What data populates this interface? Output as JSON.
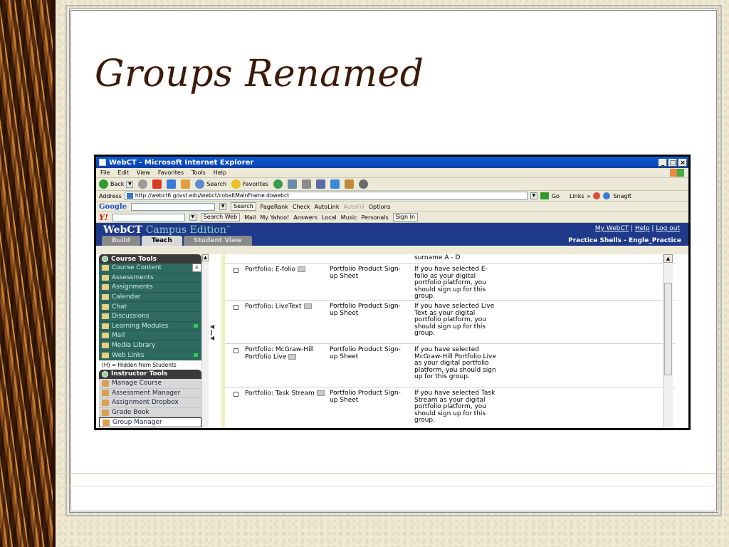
{
  "slide": {
    "title": "Groups Renamed"
  },
  "browser": {
    "window_title": "WebCT - Microsoft Internet Explorer",
    "window_buttons": [
      "_",
      "□",
      "×"
    ],
    "menu": [
      "File",
      "Edit",
      "View",
      "Favorites",
      "Tools",
      "Help"
    ],
    "toolbar": {
      "back": "Back",
      "search": "Search",
      "favorites": "Favorites"
    },
    "address_label": "Address",
    "address_value": "http://webct6.govst.edu/webct/cobaltMainFrame.dowebct",
    "go_label": "Go",
    "links_label": "Links",
    "snagit_label": "SnagIt"
  },
  "google_bar": {
    "logo": "Google",
    "search_label": "Search",
    "pagerank_label": "PageRank",
    "check_label": "Check",
    "autolink_label": "AutoLink",
    "autofill_label": "AutoFill",
    "options_label": "Options"
  },
  "yahoo_bar": {
    "logo": "Y!",
    "search_web_label": "Search Web",
    "items": [
      "Mail",
      "My Yahoo!",
      "Answers",
      "Local",
      "Music",
      "Personals",
      "Sign In"
    ]
  },
  "webct": {
    "logo": "WebCT",
    "edition": "Campus Edition",
    "trademark": "™",
    "header_links": [
      "My WebCT",
      "Help",
      "Log out"
    ],
    "tabs": [
      "Build",
      "Teach",
      "Student View"
    ],
    "active_tab": "Teach",
    "course_name": "Practice Shells - Engle_Practice"
  },
  "sidebar": {
    "course_tools_header": "Course Tools",
    "course_tools": [
      "Course Content",
      "Assessments",
      "Assignments",
      "Calendar",
      "Chat",
      "Discussions",
      "Learning Modules",
      "Mail",
      "Media Library",
      "Web Links"
    ],
    "hidden_note": "(H) = Hidden from Students",
    "instructor_tools_header": "Instructor Tools",
    "instructor_tools": [
      "Manage Course",
      "Assessment Manager",
      "Assignment Dropbox",
      "Grade Book",
      "Group Manager"
    ],
    "selected_instructor_tool": "Group Manager"
  },
  "groups_table": {
    "top_fragment": "surname A - D",
    "rows": [
      {
        "name": "Portfolio: E-folio",
        "sheet": "Portfolio Product Sign-up Sheet",
        "desc": "If you have selected E-folio as your digital portfolio platform, you should sign up for this group."
      },
      {
        "name": "Portfolio: LiveText",
        "sheet": "Portfolio Product Sign-up Sheet",
        "desc": "If you have selected Live Text as your digital portfolio platform, you should sign up for this group."
      },
      {
        "name": "Portfolio: McGraw-Hill Portfolio Live",
        "sheet": "Portfolio Product Sign-up Sheet",
        "desc": "If you have selected McGraw-Hill Portfolio Live as your digital portfolio platform, you should sign up for this group."
      },
      {
        "name": "Portfolio: Task Stream",
        "sheet": "Portfolio Product Sign-up Sheet",
        "desc": "If you have selected Task Stream as your digital portfolio platform, you should sign up for this group."
      }
    ]
  }
}
